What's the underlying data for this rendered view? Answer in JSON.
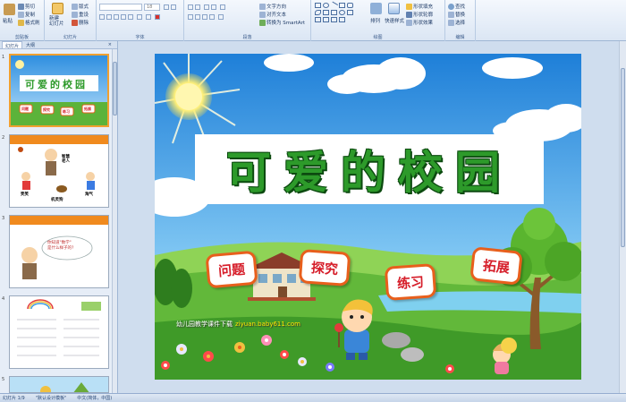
{
  "ribbon": {
    "groups": [
      {
        "label": "剪贴板"
      },
      {
        "label": "幻灯片"
      },
      {
        "label": "字体"
      },
      {
        "label": "段落"
      },
      {
        "label": "绘图"
      },
      {
        "label": "编辑"
      }
    ],
    "clipboard": {
      "paste": "粘贴",
      "cut": "剪切",
      "copy": "复制",
      "painter": "格式刷"
    },
    "slides": {
      "new_slide": "新建\n幻灯片",
      "layout": "版式",
      "reset": "重设",
      "delete": "删除"
    },
    "font": {
      "font_size": "18"
    },
    "paragraph": {
      "text_direction": "文字方向",
      "align_text": "对齐文本",
      "smartart": "转换为 SmartArt"
    },
    "drawing": {
      "arrange": "排列",
      "quick_styles": "快速样式",
      "fill": "形状填充",
      "outline": "形状轮廓",
      "effects": "形状效果"
    },
    "editing": {
      "find": "查找",
      "replace": "替换",
      "select": "选择"
    }
  },
  "leftpane": {
    "tabs": [
      "幻灯片",
      "大纲"
    ],
    "thumbs": [
      {
        "num": "1",
        "title": "可爱的校园",
        "badges": [
          "问题",
          "探究",
          "练习",
          "拓展"
        ]
      },
      {
        "num": "2",
        "labels": [
          "智慧\n老人",
          "笑笑",
          "淘气",
          "机灵狗"
        ]
      },
      {
        "num": "3",
        "speech": "你知道\"数学\"\n是什么样子的?"
      },
      {
        "num": "4"
      },
      {
        "num": "5"
      }
    ]
  },
  "slide": {
    "title": "可爱的校园",
    "badges": [
      "问题",
      "探究",
      "练习",
      "拓展"
    ],
    "watermark_text": "幼儿园教学课件下载",
    "watermark_url": "ziyuan.baby611.com"
  },
  "statusbar": {
    "slide_info": "幻灯片 1/9",
    "theme": "\"默认设计模板\"",
    "language": "中文(简体，中国)"
  },
  "colors": {
    "title_green": "#2d9a2a",
    "badge_border": "#e85f1c",
    "badge_text": "#d61e2a",
    "selection": "#f0a030"
  }
}
